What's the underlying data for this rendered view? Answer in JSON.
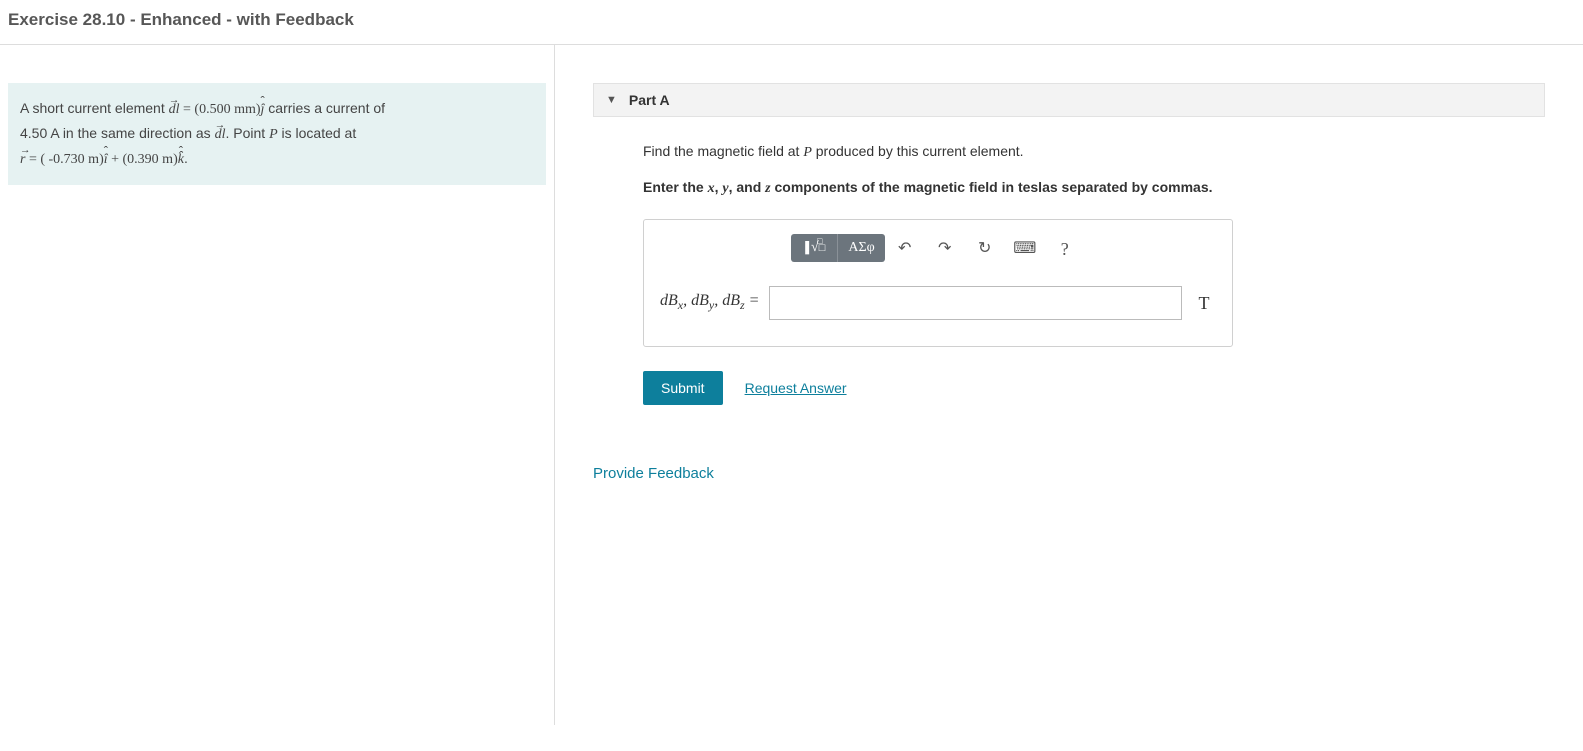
{
  "header": {
    "title": "Exercise 28.10 - Enhanced - with Feedback"
  },
  "problem": {
    "text1a": "A short current element ",
    "dl_eq": " = (0.500 mm)",
    "text1b": " carries a current of",
    "text2a": "4.50 A in the same direction as ",
    "text2b": ". Point ",
    "text2c": " is located at",
    "text3a": " = ( -0.730 m)",
    "text3b": " + (0.390 m)",
    "text3c": "."
  },
  "part": {
    "label": "Part A",
    "prompt_a": "Find the magnetic field at ",
    "prompt_b": " produced by this current element.",
    "instructions_a": "Enter the ",
    "instructions_b": ", and ",
    "instructions_c": " components of the magnetic field in teslas separated by commas."
  },
  "toolbar": {
    "math": "√",
    "greek": "ΑΣφ",
    "undo": "↶",
    "redo": "↷",
    "reset": "↻",
    "keyboard": "⌨",
    "help": "?"
  },
  "input": {
    "var_label_html": "dBₓ, dBᵧ, dB_z =",
    "unit": "T",
    "value": ""
  },
  "actions": {
    "submit": "Submit",
    "request": "Request Answer"
  },
  "feedback_link": "Provide Feedback"
}
